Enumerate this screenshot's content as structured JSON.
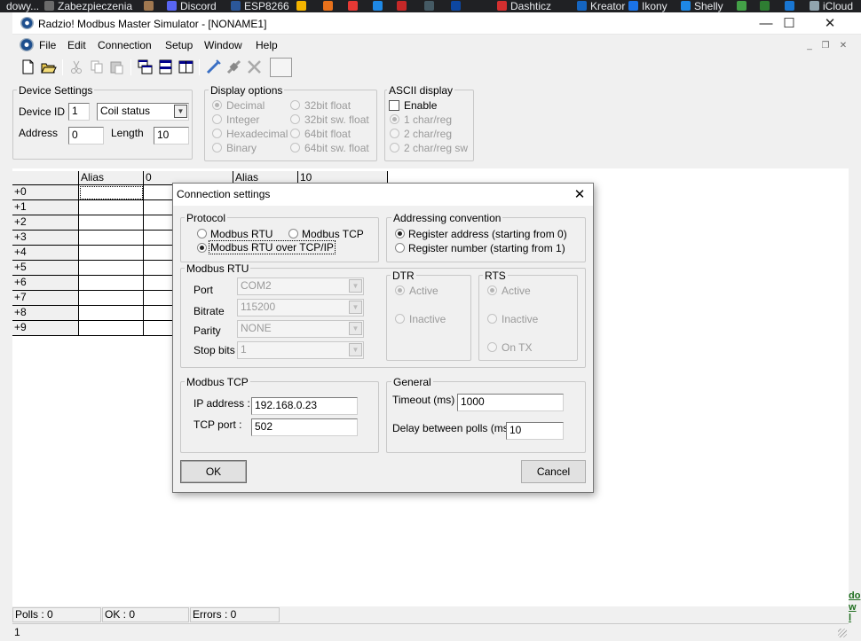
{
  "bookmarks": [
    {
      "label": "dowy...",
      "color": "#202124"
    },
    {
      "label": "Zabezpieczenia",
      "color": "#6b6b6b"
    },
    {
      "label": "",
      "color": "#a07850"
    },
    {
      "label": "Discord",
      "color": "#5865f2"
    },
    {
      "label": "ESP8266",
      "color": "#2b579a"
    },
    {
      "label": "",
      "color": "#f4b400"
    },
    {
      "label": "",
      "color": "#e8711b"
    },
    {
      "label": "",
      "color": "#e53935"
    },
    {
      "label": "",
      "color": "#1e88e5"
    },
    {
      "label": "",
      "color": "#c62828"
    },
    {
      "label": "",
      "color": "#455a64"
    },
    {
      "label": "",
      "color": "#0d47a1"
    },
    {
      "label": "Dashticz",
      "color": "#d32f2f"
    },
    {
      "label": "Kreator",
      "color": "#1565c0"
    },
    {
      "label": "Ikony",
      "color": "#1a73e8"
    },
    {
      "label": "Shelly",
      "color": "#1e88e5"
    },
    {
      "label": "",
      "color": "#43a047"
    },
    {
      "label": "",
      "color": "#2e7d32"
    },
    {
      "label": "",
      "color": "#1976d2"
    },
    {
      "label": "iCloud",
      "color": "#90a4ae"
    }
  ],
  "window": {
    "title": "Radzio! Modbus Master Simulator - [NONAME1]",
    "minimize": "—",
    "maximize": "☐",
    "close": "✕"
  },
  "menu": [
    "File",
    "Edit",
    "Connection",
    "Setup",
    "Window",
    "Help"
  ],
  "mdi_controls": {
    "minimize": "_",
    "restore": "❐",
    "close": "✕"
  },
  "toolbar_icons": [
    "new-file-icon",
    "open-folder-icon",
    "cut-icon",
    "copy-icon",
    "paste-icon",
    "cascade-windows-icon",
    "tile-horizontal-icon",
    "tile-vertical-icon",
    "connect-icon",
    "disconnect-icon",
    "tools-icon",
    "blank-button"
  ],
  "device_settings": {
    "legend": "Device Settings",
    "device_id_label": "Device ID",
    "device_id": "1",
    "register_type": "Coil status",
    "address_label": "Address",
    "address": "0",
    "length_label": "Length",
    "length": "10"
  },
  "display_options": {
    "legend": "Display options",
    "options": [
      "Decimal",
      "Integer",
      "Hexadecimal",
      "Binary",
      "32bit float",
      "32bit sw. float",
      "64bit float",
      "64bit sw. float"
    ],
    "selected": "Decimal"
  },
  "ascii_display": {
    "legend": "ASCII display",
    "enable_label": "Enable",
    "enabled": false,
    "options": [
      "1 char/reg",
      "2 char/reg",
      "2 char/reg sw"
    ],
    "selected": "1 char/reg"
  },
  "grid": {
    "headers": [
      "",
      "Alias",
      "0",
      "Alias",
      "10"
    ],
    "rows": [
      "+0",
      "+1",
      "+2",
      "+3",
      "+4",
      "+5",
      "+6",
      "+7",
      "+8",
      "+9"
    ]
  },
  "status": {
    "polls": "Polls : 0",
    "ok": "OK : 0",
    "errors": "Errors : 0",
    "bottom": "1"
  },
  "right_edge_text": "do\nw l",
  "dialog": {
    "title": "Connection settings",
    "close": "✕",
    "protocol": {
      "legend": "Protocol",
      "rtu": "Modbus RTU",
      "tcp": "Modbus TCP",
      "rtu_over_tcp": "Modbus RTU over TCP/IP",
      "selected": "Modbus RTU over TCP/IP"
    },
    "addressing": {
      "legend": "Addressing convention",
      "from0": "Register address (starting from 0)",
      "from1": "Register number (starting from 1)",
      "selected": "Register address (starting from 0)"
    },
    "modbus_rtu": {
      "legend": "Modbus RTU",
      "port_label": "Port",
      "port": "COM2",
      "bitrate_label": "Bitrate",
      "bitrate": "115200",
      "parity_label": "Parity",
      "parity": "NONE",
      "stopbits_label": "Stop bits",
      "stopbits": "1"
    },
    "dtr": {
      "legend": "DTR",
      "active": "Active",
      "inactive": "Inactive"
    },
    "rts": {
      "legend": "RTS",
      "active": "Active",
      "inactive": "Inactive",
      "ontx": "On TX"
    },
    "modbus_tcp": {
      "legend": "Modbus TCP",
      "ip_label": "IP address :",
      "ip": "192.168.0.23",
      "port_label": "TCP port :",
      "port": "502"
    },
    "general": {
      "legend": "General",
      "timeout_label": "Timeout (ms)",
      "timeout": "1000",
      "delay_label": "Delay between polls (ms)",
      "delay": "10"
    },
    "ok": "OK",
    "cancel": "Cancel"
  }
}
